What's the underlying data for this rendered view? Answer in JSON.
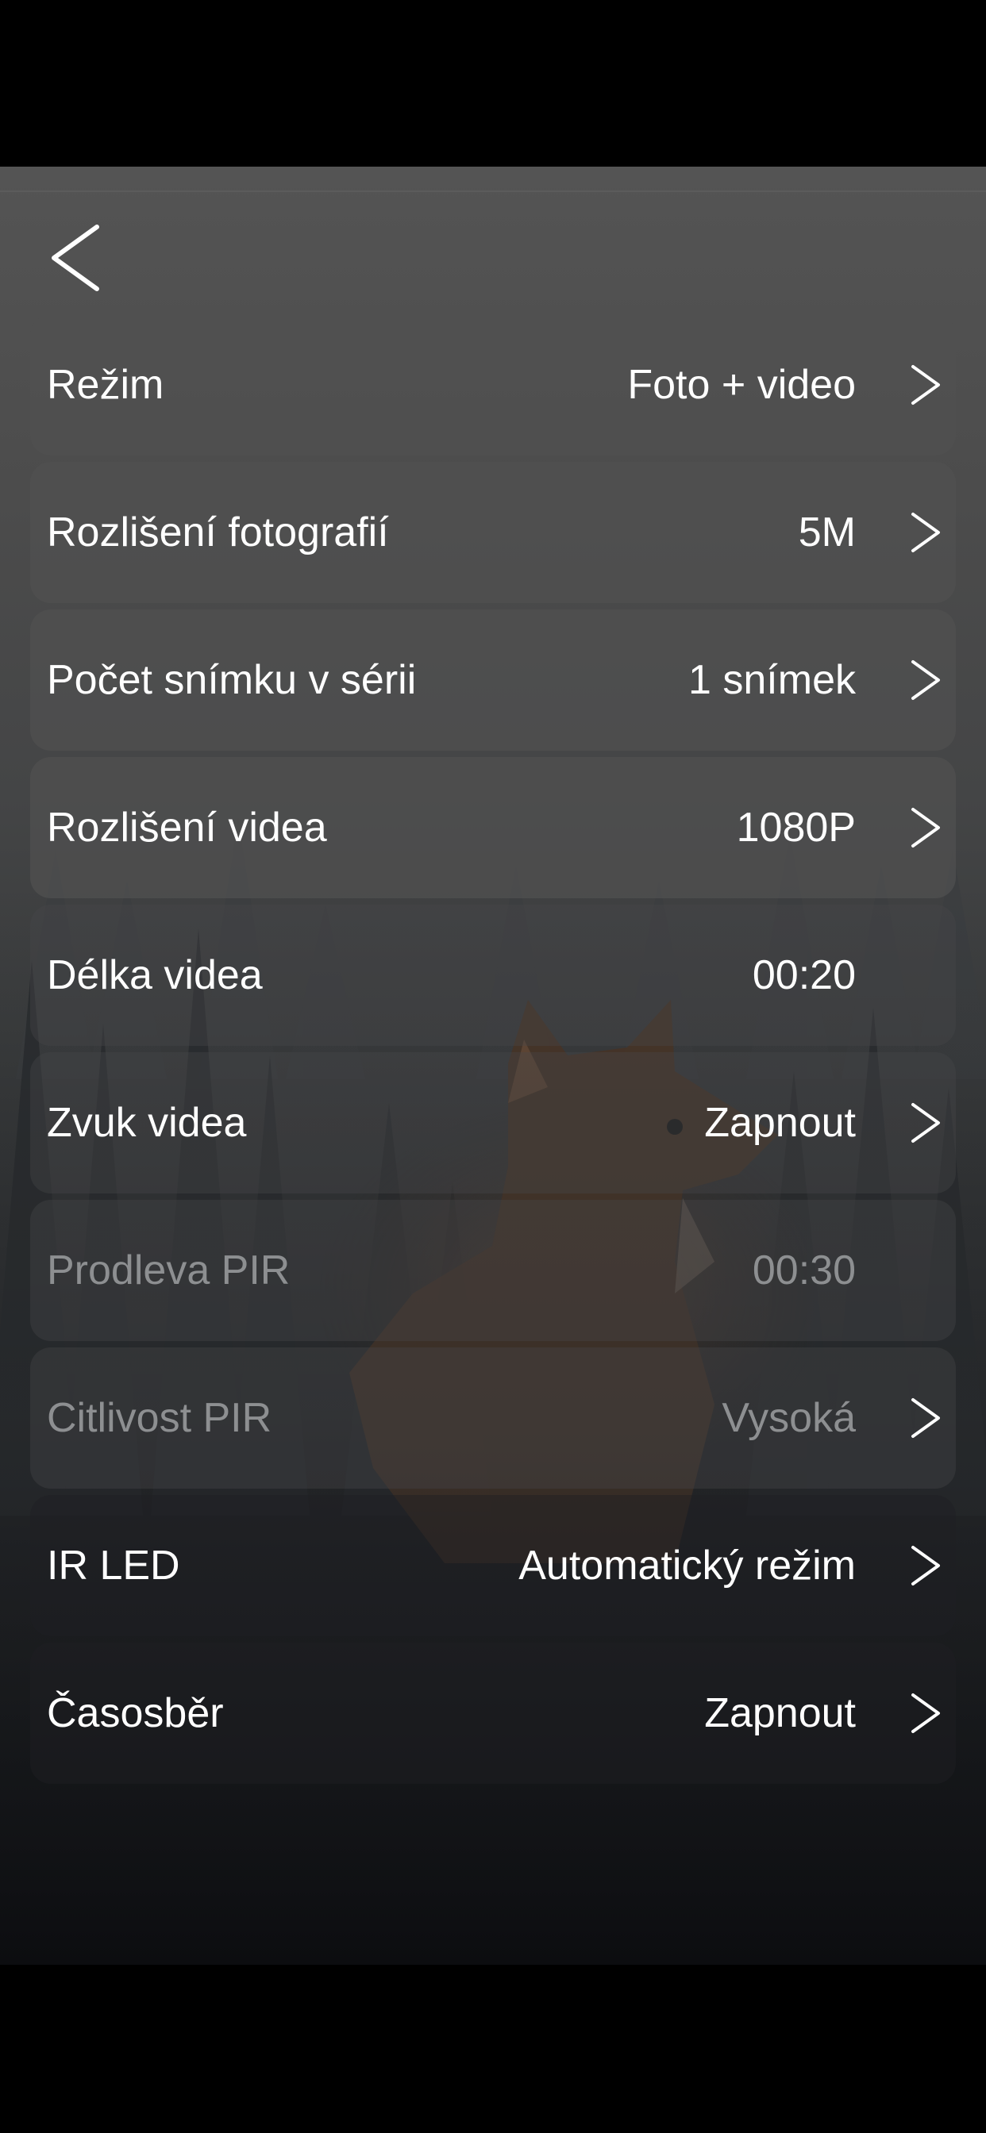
{
  "header": {
    "back_icon": "chevron-left-icon"
  },
  "settings": [
    {
      "label": "Režim",
      "value": "Foto + video",
      "chevron": true,
      "disabled": false
    },
    {
      "label": "Rozlišení fotografií",
      "value": "5M",
      "chevron": true,
      "disabled": false
    },
    {
      "label": "Počet snímku v sérii",
      "value": "1 snímek",
      "chevron": true,
      "disabled": false
    },
    {
      "label": "Rozlišení videa",
      "value": "1080P",
      "chevron": true,
      "disabled": false
    },
    {
      "label": "Délka videa",
      "value": "00:20",
      "chevron": false,
      "disabled": false
    },
    {
      "label": "Zvuk videa",
      "value": "Zapnout",
      "chevron": true,
      "disabled": false
    },
    {
      "label": "Prodleva PIR",
      "value": "00:30",
      "chevron": false,
      "disabled": true
    },
    {
      "label": "Citlivost PIR",
      "value": "Vysoká",
      "chevron": true,
      "disabled": true
    },
    {
      "label": "IR LED",
      "value": "Automatický režim",
      "chevron": true,
      "disabled": false
    },
    {
      "label": "Časosběr",
      "value": "Zapnout",
      "chevron": true,
      "disabled": false
    }
  ],
  "icons": {
    "row_chevron": "chevron-right-icon"
  },
  "background": {
    "subject": "fox-in-misty-forest"
  }
}
